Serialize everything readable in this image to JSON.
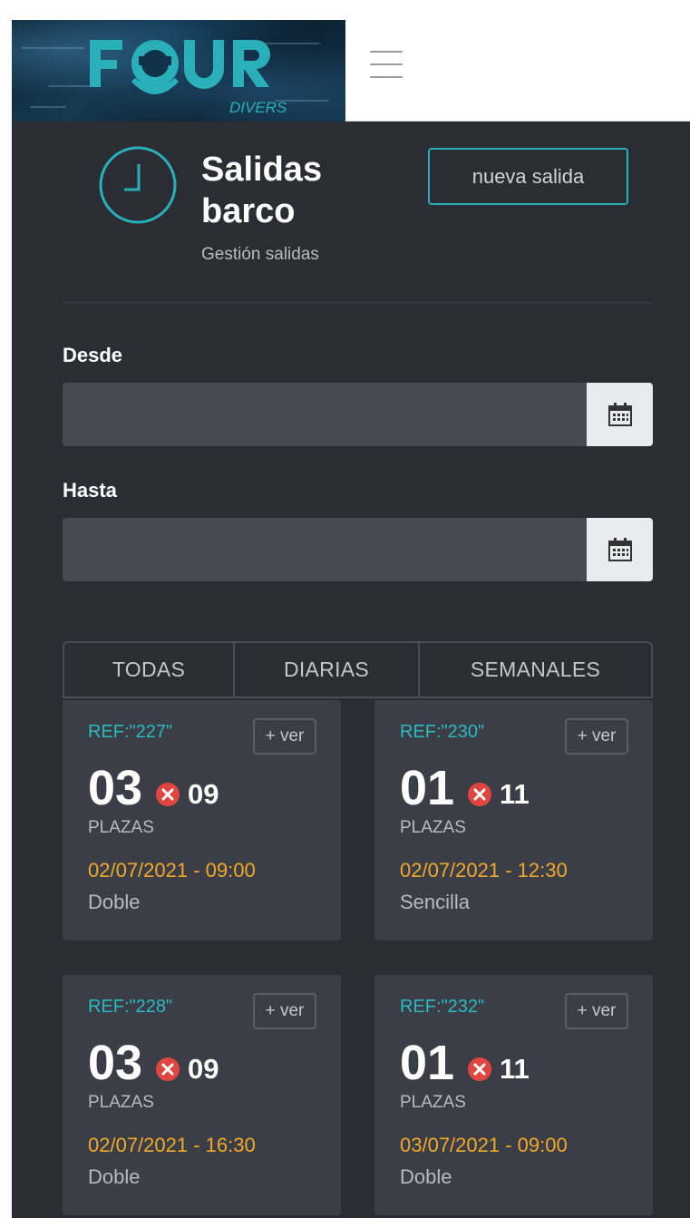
{
  "header": {
    "logo_text": "FOUR",
    "logo_subtext": "DIVERS",
    "menu_icon": "hamburger-menu-icon"
  },
  "page": {
    "title_line1": "Salidas",
    "title_line2": "barco",
    "subtitle": "Gestión salidas",
    "icon": "clock-icon",
    "new_button": "nueva salida"
  },
  "filters": {
    "from_label": "Desde",
    "from_value": "",
    "to_label": "Hasta",
    "to_value": "",
    "calendar_icon": "calendar-icon"
  },
  "tabs": [
    {
      "label": "TODAS"
    },
    {
      "label": "DIARIAS"
    },
    {
      "label": "SEMANALES"
    }
  ],
  "cards": [
    {
      "ref": "REF:\"227\"",
      "ver": "+ ver",
      "available": "03",
      "cancelled": "09",
      "plazas": "PLAZAS",
      "datetime": "02/07/2021 - 09:00",
      "type": "Doble"
    },
    {
      "ref": "REF:\"230\"",
      "ver": "+ ver",
      "available": "01",
      "cancelled": "11",
      "plazas": "PLAZAS",
      "datetime": "02/07/2021 - 12:30",
      "type": "Sencilla"
    },
    {
      "ref": "REF:\"228\"",
      "ver": "+ ver",
      "available": "03",
      "cancelled": "09",
      "plazas": "PLAZAS",
      "datetime": "02/07/2021 - 16:30",
      "type": "Doble"
    },
    {
      "ref": "REF:\"232\"",
      "ver": "+ ver",
      "available": "01",
      "cancelled": "11",
      "plazas": "PLAZAS",
      "datetime": "03/07/2021 - 09:00",
      "type": "Doble"
    }
  ],
  "colors": {
    "accent_teal": "#2ab0b8",
    "date_orange": "#f0a92a",
    "cancel_red": "#e0463f",
    "background": "#2b2d35",
    "card": "#3b3e47"
  }
}
